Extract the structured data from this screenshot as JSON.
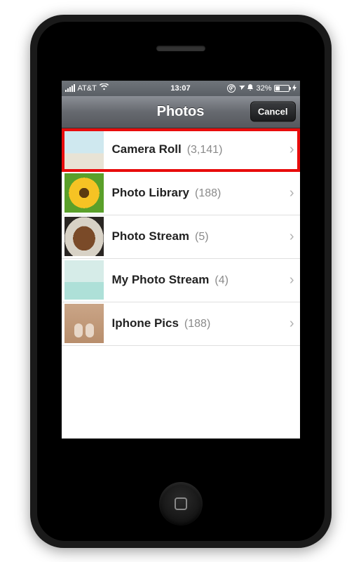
{
  "status_bar": {
    "carrier": "AT&T",
    "time": "13:07",
    "battery_pct": "32%"
  },
  "nav": {
    "title": "Photos",
    "cancel_label": "Cancel"
  },
  "albums": [
    {
      "name": "Camera Roll",
      "count": "(3,141)",
      "thumb": "camera-roll",
      "highlighted": true
    },
    {
      "name": "Photo Library",
      "count": "(188)",
      "thumb": "sunflower",
      "highlighted": false
    },
    {
      "name": "Photo Stream",
      "count": "(5)",
      "thumb": "food",
      "highlighted": false
    },
    {
      "name": "My Photo Stream",
      "count": "(4)",
      "thumb": "stream",
      "highlighted": false
    },
    {
      "name": "Iphone Pics",
      "count": "(188)",
      "thumb": "feet",
      "highlighted": false
    }
  ]
}
